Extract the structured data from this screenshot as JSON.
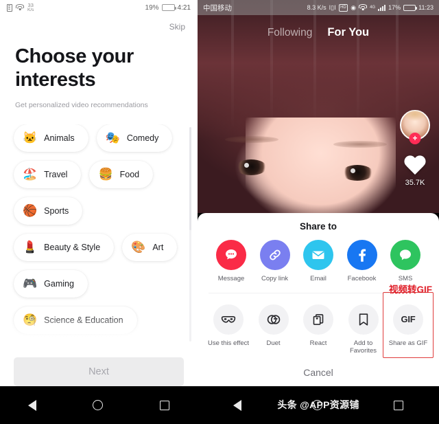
{
  "left": {
    "status": {
      "speed_value": "33",
      "speed_unit": "K/s",
      "battery_pct": "19%",
      "clock": "4:21"
    },
    "skip_label": "Skip",
    "title": "Choose your interests",
    "subtitle": "Get personalized video recommendations",
    "chips": [
      {
        "emoji": "🐱",
        "label": "Animals",
        "icon": "cat-face-emoji"
      },
      {
        "emoji": "🎭",
        "label": "Comedy",
        "icon": "comedy-emoji"
      },
      {
        "emoji": "🏖️",
        "label": "Travel",
        "icon": "beach-umbrella-emoji"
      },
      {
        "emoji": "🍔",
        "label": "Food",
        "icon": "hamburger-emoji"
      },
      {
        "emoji": "🏀",
        "label": "Sports",
        "icon": "basketball-emoji"
      },
      {
        "emoji": "💄",
        "label": "Beauty & Style",
        "icon": "lipstick-emoji"
      },
      {
        "emoji": "🎨",
        "label": "Art",
        "icon": "palette-emoji"
      },
      {
        "emoji": "🎮",
        "label": "Gaming",
        "icon": "game-controller-emoji"
      },
      {
        "emoji": "🧐",
        "label": "Science & Education",
        "icon": "monocle-face-emoji"
      }
    ],
    "next_label": "Next"
  },
  "right": {
    "status": {
      "carrier": "中国移动",
      "speed": "8.3 K/s",
      "network": "4G",
      "battery_pct": "17%",
      "clock": "11:23"
    },
    "feed_tabs": [
      {
        "label": "Following",
        "active": false
      },
      {
        "label": "For You",
        "active": true
      }
    ],
    "rail": {
      "follow_plus": "+",
      "like_count": "35.7K"
    },
    "sheet": {
      "title": "Share to",
      "share_targets": [
        {
          "label": "Message",
          "icon": "message-bubble-icon",
          "color": "#fa2b47"
        },
        {
          "label": "Copy link",
          "icon": "link-chain-icon",
          "color": "#7a7ff0"
        },
        {
          "label": "Email",
          "icon": "envelope-icon",
          "color": "#2ec5ee"
        },
        {
          "label": "Facebook",
          "icon": "facebook-icon",
          "color": "#1877f2"
        },
        {
          "label": "SMS",
          "icon": "sms-bubble-icon",
          "color": "#2ec45f"
        }
      ],
      "actions": [
        {
          "label": "Use this effect",
          "icon": "effect-mask-icon",
          "highlighted": false
        },
        {
          "label": "Duet",
          "icon": "duet-circles-icon",
          "highlighted": false
        },
        {
          "label": "React",
          "icon": "react-frames-icon",
          "highlighted": false
        },
        {
          "label": "Add to Favorites",
          "icon": "bookmark-icon",
          "highlighted": false
        },
        {
          "label": "Share as GIF",
          "icon": "gif-text-icon",
          "highlighted": true,
          "glyph": "GIF"
        }
      ],
      "annotation": "视频转GIF",
      "annotation_color": "#e0202a",
      "cancel_label": "Cancel"
    },
    "watermark": "头条 @APP资源铺"
  }
}
